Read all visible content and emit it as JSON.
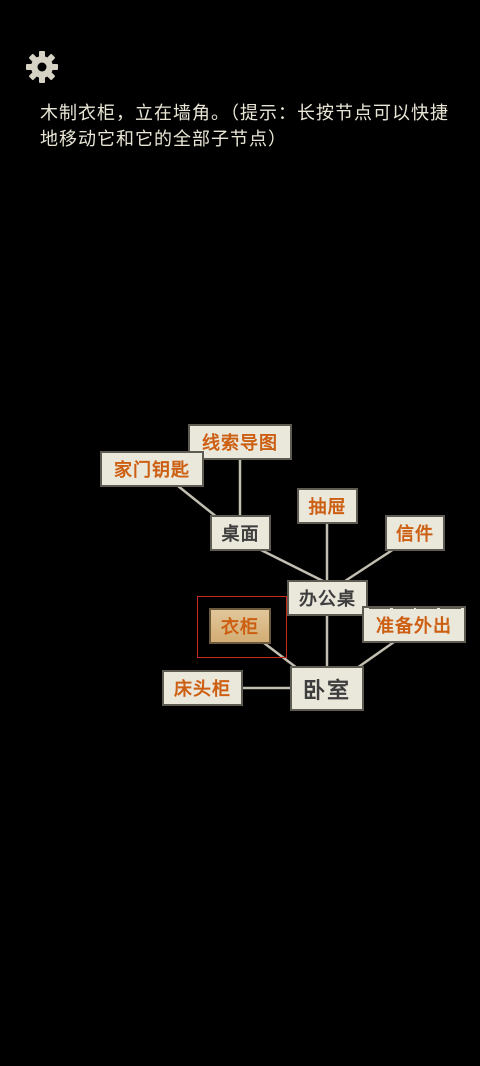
{
  "description": "木制衣柜，立在墙角。（提示：长按节点可以快捷地移动它和它的全部子节点）",
  "icons": {
    "settings": "gear-icon"
  },
  "colors": {
    "background": "#000000",
    "node_fill": "#eae7db",
    "node_border": "#5e5b52",
    "highlight_text": "#cc5f12",
    "plain_text": "#3e3e3e",
    "selected_fill": "#d8b47c",
    "selection_outline": "#c4281c"
  },
  "nodes": {
    "bedroom": "卧室",
    "desk": "办公桌",
    "desktop": "桌面",
    "clue_map": "线索导图",
    "house_key": "家门钥匙",
    "drawer": "抽屉",
    "letter": "信件",
    "prepare_out": "准备外出",
    "wardrobe": "衣柜",
    "nightstand": "床头柜"
  }
}
